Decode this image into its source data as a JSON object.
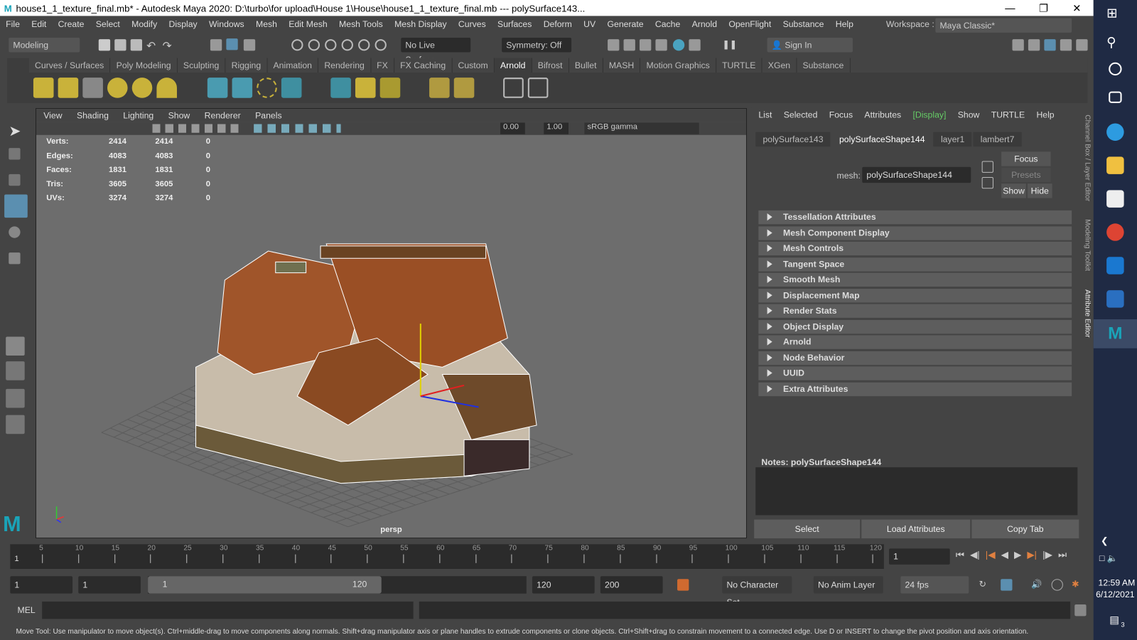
{
  "window": {
    "title": "house1_1_texture_final.mb* - Autodesk Maya 2020: D:\\turbo\\for upload\\House 1\\House\\house1_1_texture_final.mb  ---  polySurface143...",
    "logo": "M"
  },
  "menu": [
    "File",
    "Edit",
    "Create",
    "Select",
    "Modify",
    "Display",
    "Windows",
    "Mesh",
    "Edit Mesh",
    "Mesh Tools",
    "Mesh Display",
    "Curves",
    "Surfaces",
    "Deform",
    "UV",
    "Generate",
    "Cache",
    "Arnold",
    "OpenFlight",
    "Substance",
    "Help"
  ],
  "workspace": {
    "label": "Workspace :",
    "value": "Maya Classic*"
  },
  "toolbar": {
    "mode": "Modeling",
    "live_surface": "No Live Surface",
    "symmetry": "Symmetry: Off",
    "sign_in": "Sign In"
  },
  "shelf_tabs": [
    "Curves / Surfaces",
    "Poly Modeling",
    "Sculpting",
    "Rigging",
    "Animation",
    "Rendering",
    "FX",
    "FX Caching",
    "Custom",
    "Arnold",
    "Bifrost",
    "Bullet",
    "MASH",
    "Motion Graphics",
    "TURTLE",
    "XGen",
    "Substance"
  ],
  "shelf_active": "Arnold",
  "viewport": {
    "menu": [
      "View",
      "Shading",
      "Lighting",
      "Show",
      "Renderer",
      "Panels"
    ],
    "exposure": "0.00",
    "gamma": "1.00",
    "color_space": "sRGB gamma",
    "camera": "persp",
    "hud": [
      {
        "label": "Verts:",
        "a": "2414",
        "b": "2414",
        "c": "0"
      },
      {
        "label": "Edges:",
        "a": "4083",
        "b": "4083",
        "c": "0"
      },
      {
        "label": "Faces:",
        "a": "1831",
        "b": "1831",
        "c": "0"
      },
      {
        "label": "Tris:",
        "a": "3605",
        "b": "3605",
        "c": "0"
      },
      {
        "label": "UVs:",
        "a": "3274",
        "b": "3274",
        "c": "0"
      }
    ]
  },
  "attr_editor": {
    "menu": [
      "List",
      "Selected",
      "Focus",
      "Attributes",
      "[Display]",
      "Show",
      "TURTLE",
      "Help"
    ],
    "tabs": [
      "polySurface143",
      "polySurfaceShape144",
      "layer1",
      "lambert7"
    ],
    "active_tab": "polySurfaceShape144",
    "mesh_label": "mesh:",
    "mesh_value": "polySurfaceShape144",
    "focus": "Focus",
    "presets": "Presets",
    "show": "Show",
    "hide": "Hide",
    "sections": [
      "Tessellation Attributes",
      "Mesh Component Display",
      "Mesh Controls",
      "Tangent Space",
      "Smooth Mesh",
      "Displacement Map",
      "Render Stats",
      "Object Display",
      "Arnold",
      "Node Behavior",
      "UUID",
      "Extra Attributes"
    ],
    "notes_label": "Notes:  polySurfaceShape144",
    "select": "Select",
    "load_attributes": "Load Attributes",
    "copy_tab": "Copy Tab"
  },
  "side_tabs": [
    "Channel Box / Layer Editor",
    "Modeling Toolkit",
    "Attribute Editor"
  ],
  "timeline": {
    "ticks": [
      "5",
      "10",
      "15",
      "20",
      "25",
      "30",
      "35",
      "40",
      "45",
      "50",
      "55",
      "60",
      "65",
      "70",
      "75",
      "80",
      "85",
      "90",
      "95",
      "100",
      "105",
      "110",
      "115",
      "120"
    ],
    "start_label": "1",
    "current_frame": "1"
  },
  "range": {
    "start": "1",
    "anim_start": "1",
    "slider_start": "1",
    "slider_end": "120",
    "end": "120",
    "anim_end": "200",
    "character_set": "No Character Set",
    "anim_layer": "No Anim Layer",
    "fps": "24 fps"
  },
  "command": {
    "label": "MEL"
  },
  "status": "Move Tool: Use manipulator to move object(s). Ctrl+middle-drag to move components along normals. Shift+drag manipulator axis or plane handles to extrude components or clone objects. Ctrl+Shift+drag to constrain movement to a connected edge. Use D or INSERT to change the pivot position and axis orientation.",
  "clock": {
    "time": "12:59 AM",
    "date": "6/12/2021",
    "notifications": "3"
  }
}
